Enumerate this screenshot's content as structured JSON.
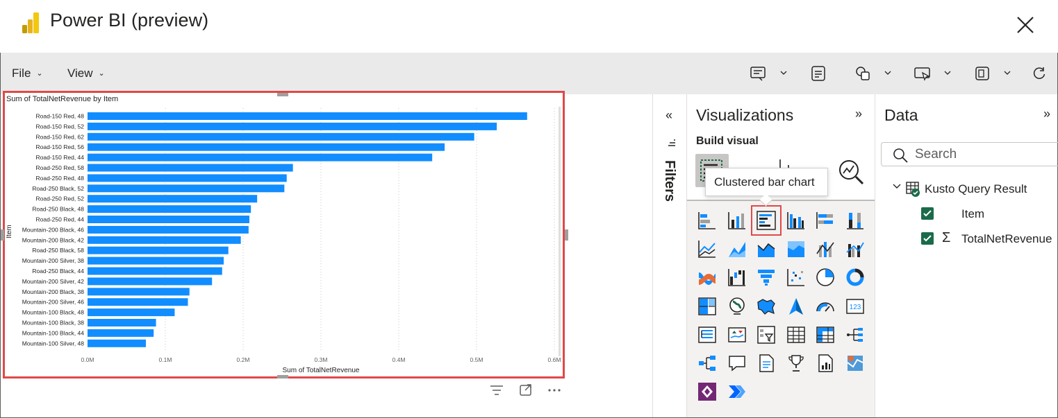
{
  "window": {
    "title": "Power BI (preview)"
  },
  "menu": {
    "file": "File",
    "view": "View"
  },
  "chart_data": {
    "type": "bar",
    "title": "Sum of TotalNetRevenue by Item",
    "xlabel": "Sum of TotalNetRevenue",
    "ylabel": "Item",
    "xlim": [
      0,
      600000
    ],
    "xticks": [
      "0.0M",
      "0.1M",
      "0.2M",
      "0.3M",
      "0.4M",
      "0.5M",
      "0.6M"
    ],
    "grid": true,
    "bar_color": "#118dff",
    "categories": [
      "Road-150 Red, 48",
      "Road-150 Red, 52",
      "Road-150 Red, 62",
      "Road-150 Red, 56",
      "Road-150 Red, 44",
      "Road-250 Red, 58",
      "Road-250 Red, 48",
      "Road-250 Black, 52",
      "Road-250 Red, 52",
      "Road-250 Black, 48",
      "Road-250 Red, 44",
      "Mountain-200 Black, 46",
      "Mountain-200 Black, 42",
      "Road-250 Black, 58",
      "Mountain-200 Silver, 38",
      "Road-250 Black, 44",
      "Mountain-200 Silver, 42",
      "Mountain-200 Black, 38",
      "Mountain-200 Silver, 46",
      "Mountain-100 Black, 48",
      "Mountain-100 Black, 38",
      "Mountain-100 Black, 44",
      "Mountain-100 Silver, 48"
    ],
    "values": [
      565000,
      526000,
      497000,
      459000,
      443000,
      264000,
      256000,
      253000,
      218000,
      210000,
      208000,
      207000,
      197000,
      181000,
      175000,
      173000,
      160000,
      131000,
      129000,
      112000,
      88000,
      85000,
      75000
    ]
  },
  "filters": {
    "label": "Filters",
    "collapse": "«"
  },
  "visualizations": {
    "title": "Visualizations",
    "expand": "»",
    "build_label": "Build visual",
    "tooltip": "Clustered bar chart"
  },
  "data_pane": {
    "title": "Data",
    "expand": "»",
    "search_placeholder": "Search",
    "table_name": "Kusto Query Result",
    "fields": [
      "Item",
      "TotalNetRevenue"
    ]
  },
  "colors": {
    "accent_red": "#e04848",
    "bar_blue": "#118dff",
    "check_green": "#1b6b4a",
    "toolbar_bg": "#eaeaea"
  }
}
